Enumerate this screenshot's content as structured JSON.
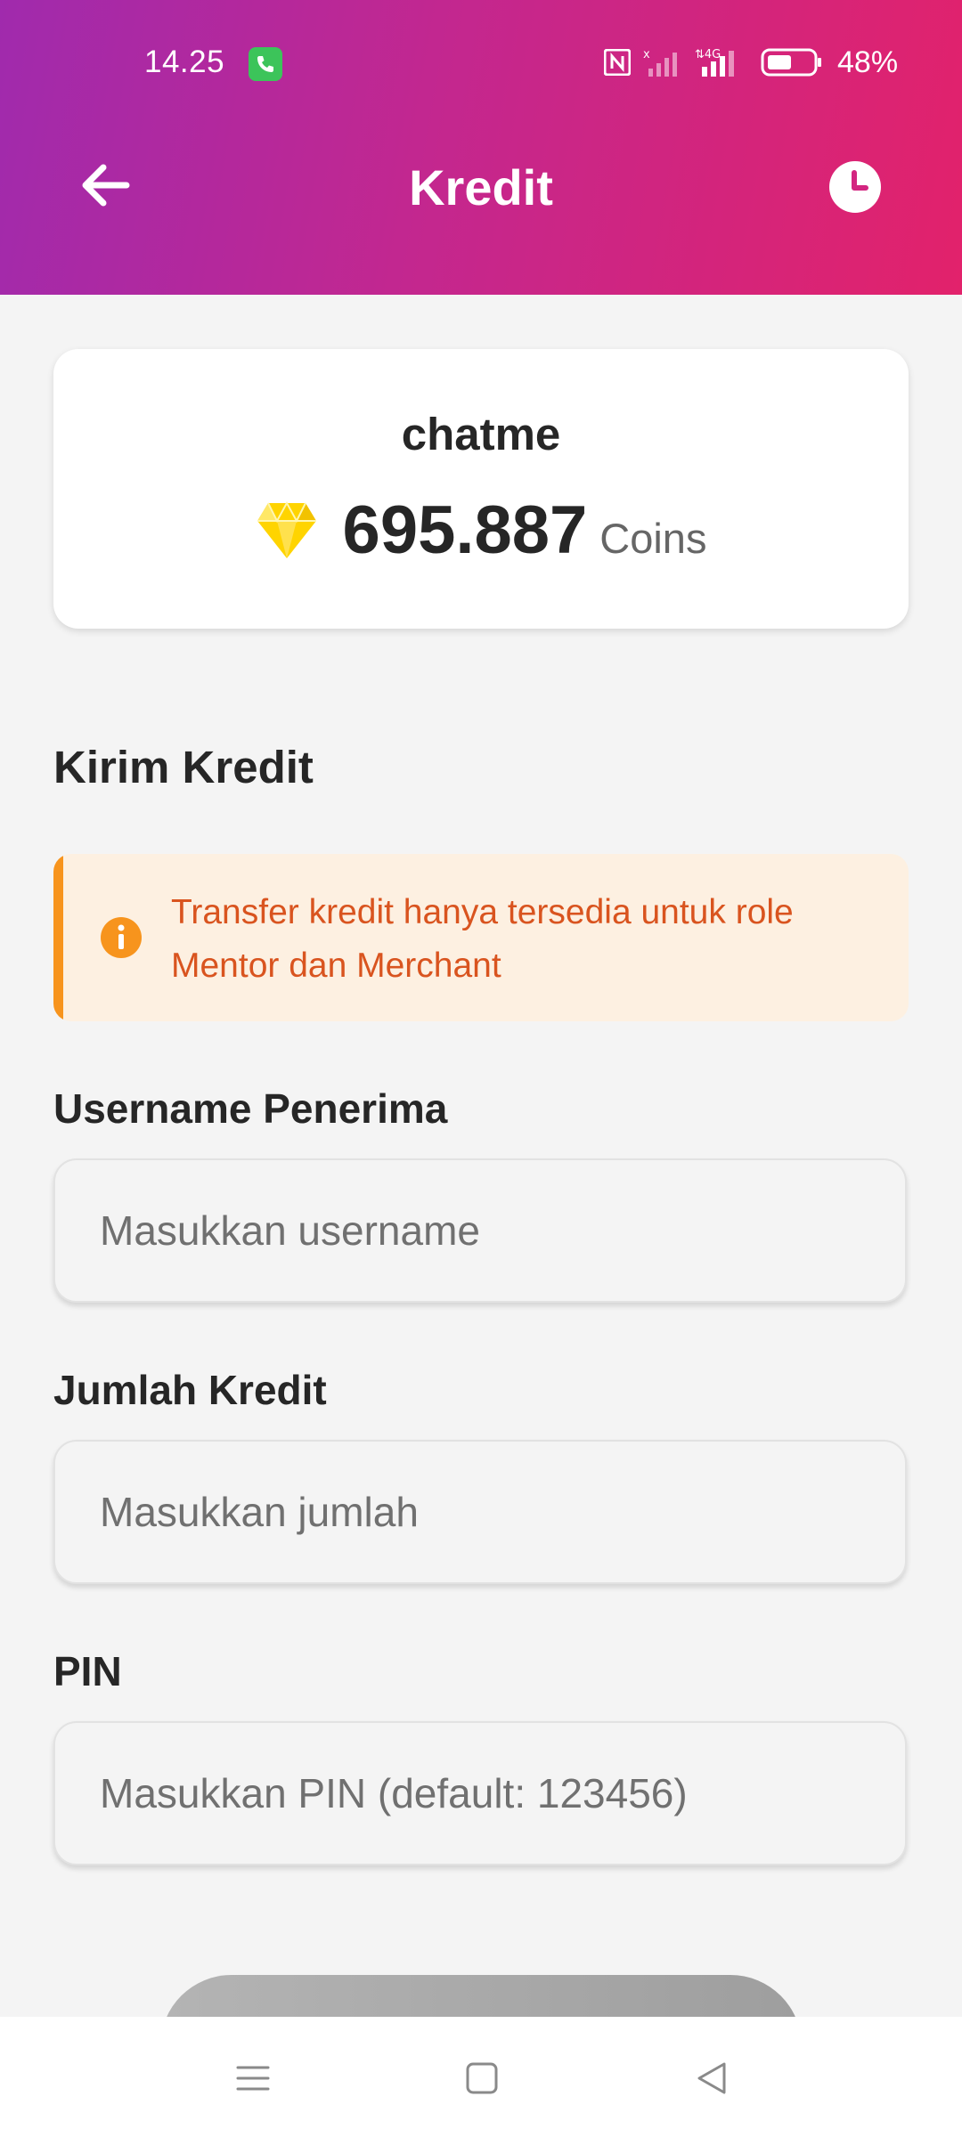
{
  "status_bar": {
    "time": "14.25",
    "battery": "48%",
    "icons": [
      "call-active-icon",
      "nfc-icon",
      "signal-no-sim-icon",
      "signal-4g-icon",
      "battery-icon"
    ]
  },
  "header": {
    "title": "Kredit",
    "back_icon": "arrow-left-icon",
    "history_icon": "clock-icon"
  },
  "balance": {
    "name": "chatme",
    "amount": "695.887",
    "unit": "Coins",
    "icon": "diamond-icon"
  },
  "send_section": {
    "title": "Kirim Kredit",
    "notice_line1": "Transfer kredit hanya tersedia untuk role",
    "notice_line2": "Mentor dan Merchant",
    "notice_icon": "info-icon"
  },
  "form": {
    "username_label": "Username Penerima",
    "username_placeholder": "Masukkan username",
    "amount_label": "Jumlah Kredit",
    "amount_placeholder": "Masukkan jumlah",
    "pin_label": "PIN",
    "pin_placeholder": "Masukkan PIN (default: 123456)"
  },
  "colors": {
    "header_gradient_start": "#a02aad",
    "header_gradient_end": "#e2226b",
    "notice_bg": "#fdf0e1",
    "notice_accent": "#f7941d",
    "notice_text": "#d9541f",
    "diamond": "#ffd400"
  },
  "nav": {
    "icons": [
      "menu-icon",
      "home-square-icon",
      "back-triangle-icon"
    ]
  }
}
